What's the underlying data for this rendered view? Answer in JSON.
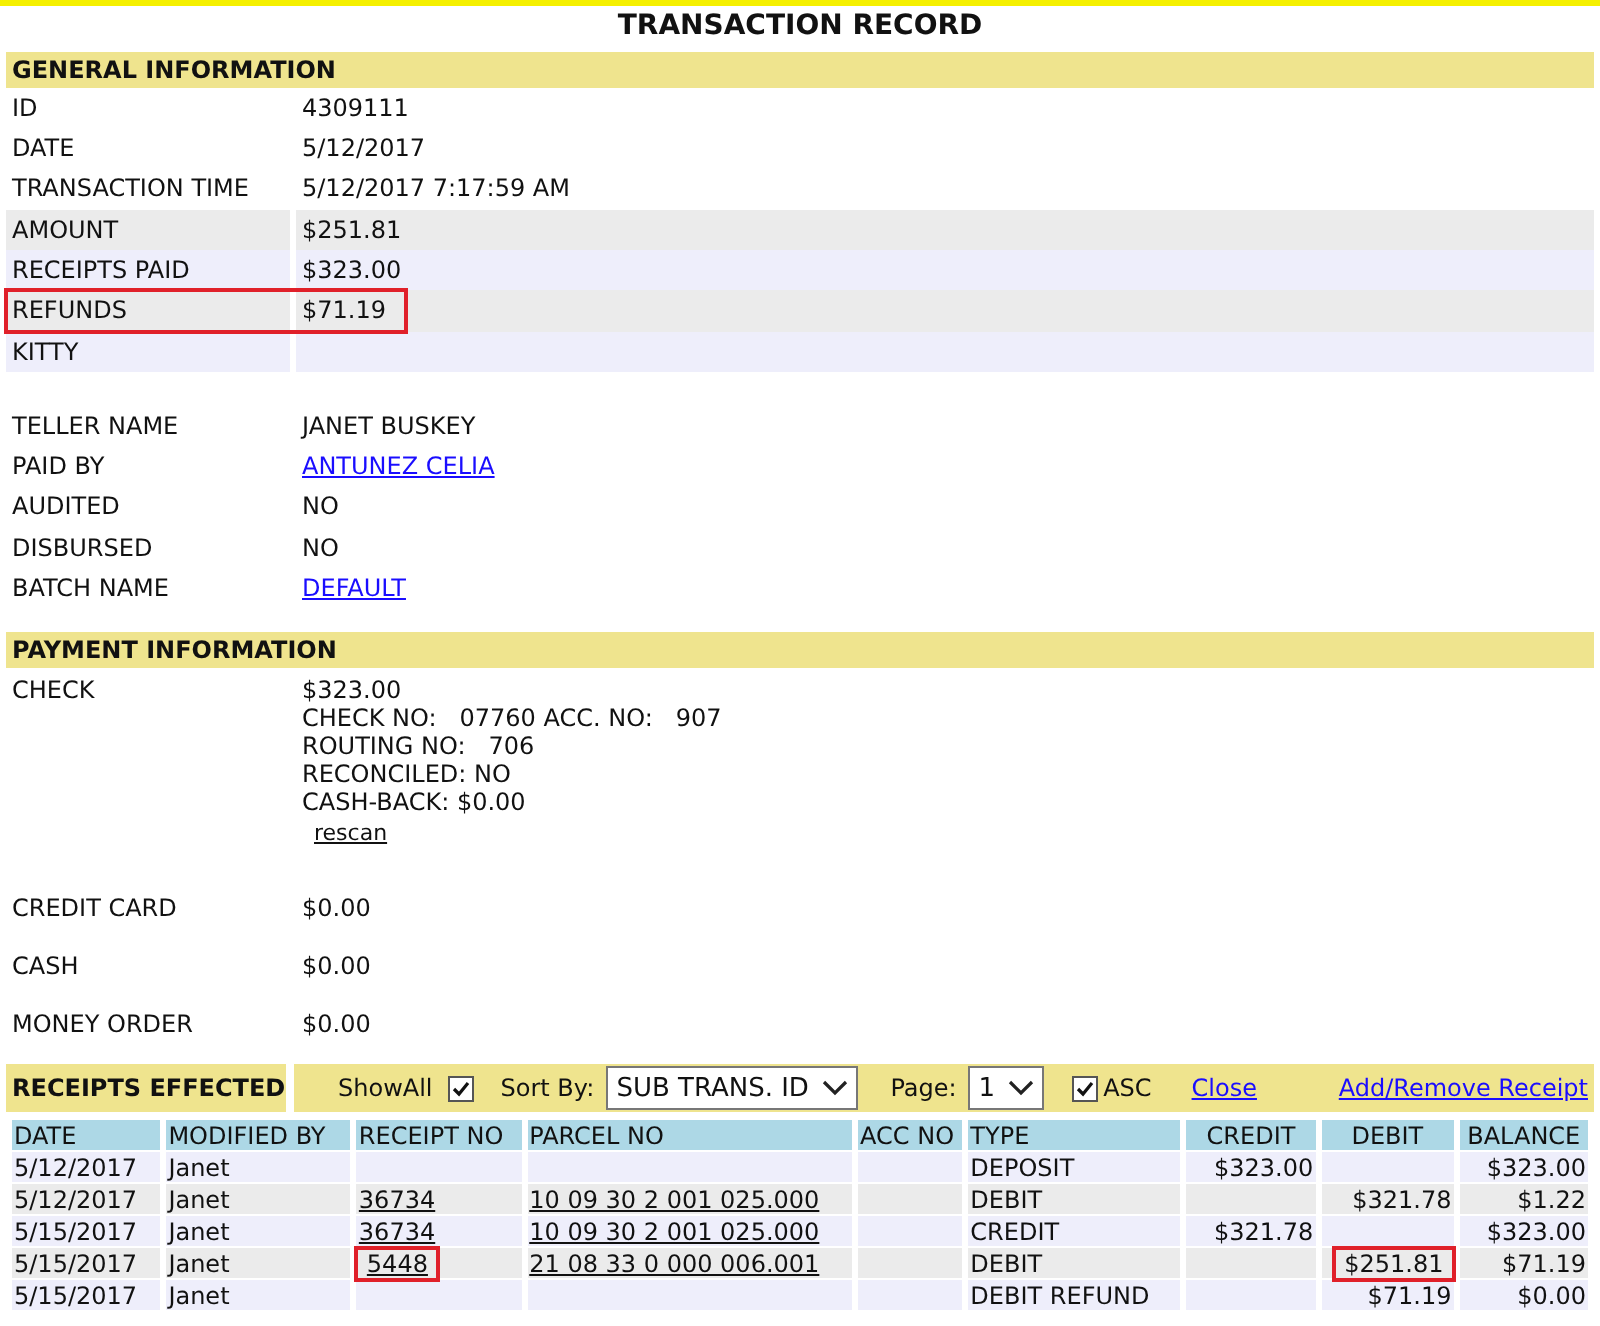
{
  "title": "TRANSACTION RECORD",
  "general": {
    "heading": "GENERAL INFORMATION",
    "basic_rows": [
      {
        "label": "ID",
        "value": "4309111"
      },
      {
        "label": "DATE",
        "value": "5/12/2017"
      },
      {
        "label": "TRANSACTION TIME",
        "value": "5/12/2017 7:17:59 AM"
      }
    ],
    "amount_rows": [
      {
        "label": "AMOUNT",
        "value": "$251.81",
        "highlighted": false
      },
      {
        "label": "RECEIPTS PAID",
        "value": "$323.00",
        "highlighted": false
      },
      {
        "label": "REFUNDS",
        "value": "$71.19",
        "highlighted": true
      },
      {
        "label": "KITTY",
        "value": "",
        "highlighted": false
      }
    ],
    "detail_rows": [
      {
        "label": "TELLER NAME",
        "value": "JANET BUSKEY",
        "kind": "text"
      },
      {
        "label": "PAID BY",
        "value": "ANTUNEZ CELIA",
        "kind": "link"
      },
      {
        "label": "AUDITED",
        "value": "NO",
        "kind": "text"
      },
      {
        "label": "DISBURSED",
        "value": "NO",
        "kind": "text"
      },
      {
        "label": "BATCH NAME",
        "value": "DEFAULT",
        "kind": "link"
      }
    ]
  },
  "payment": {
    "heading": "PAYMENT INFORMATION",
    "check": {
      "label": "CHECK",
      "amount": "$323.00",
      "lines": [
        "CHECK NO:   07760 ACC. NO:   907",
        "ROUTING NO:   706",
        "RECONCILED: NO",
        "CASH-BACK: $0.00"
      ],
      "link": "rescan"
    },
    "rows": [
      {
        "label": "CREDIT CARD",
        "value": "$0.00"
      },
      {
        "label": "CASH",
        "value": "$0.00"
      },
      {
        "label": "MONEY ORDER",
        "value": "$0.00"
      }
    ]
  },
  "receipts": {
    "heading": "RECEIPTS EFFECTED",
    "show_all": {
      "label": "ShowAll",
      "checked": true
    },
    "sort_by": {
      "label": "Sort By:",
      "value": "SUB TRANS. ID"
    },
    "page": {
      "label": "Page:",
      "value": "1"
    },
    "asc": {
      "label": "ASC",
      "checked": true
    },
    "links": [
      "Close",
      "Add/Remove Receipt"
    ],
    "columns": [
      "DATE",
      "MODIFIED BY",
      "RECEIPT NO",
      "PARCEL NO",
      "ACC NO",
      "TYPE",
      "CREDIT",
      "DEBIT",
      "BALANCE"
    ],
    "rows": [
      {
        "date": "5/12/2017",
        "modified_by": "Janet",
        "receipt_no": "",
        "parcel_no": "",
        "acc_no": "",
        "type": "DEPOSIT",
        "credit": "$323.00",
        "debit": "",
        "balance": "$323.00",
        "receipt_highlighted": false,
        "debit_highlighted": false
      },
      {
        "date": "5/12/2017",
        "modified_by": "Janet",
        "receipt_no": "36734",
        "parcel_no": "10 09 30 2 001 025.000",
        "acc_no": "",
        "type": "DEBIT",
        "credit": "",
        "debit": "$321.78",
        "balance": "$1.22",
        "receipt_highlighted": false,
        "debit_highlighted": false
      },
      {
        "date": "5/15/2017",
        "modified_by": "Janet",
        "receipt_no": "36734",
        "parcel_no": "10 09 30 2 001 025.000",
        "acc_no": "",
        "type": "CREDIT",
        "credit": "$321.78",
        "debit": "",
        "balance": "$323.00",
        "receipt_highlighted": false,
        "debit_highlighted": false
      },
      {
        "date": "5/15/2017",
        "modified_by": "Janet",
        "receipt_no": "5448",
        "parcel_no": "21 08 33 0 000 006.001",
        "acc_no": "",
        "type": "DEBIT",
        "credit": "",
        "debit": "$251.81",
        "balance": "$71.19",
        "receipt_highlighted": true,
        "debit_highlighted": true
      },
      {
        "date": "5/15/2017",
        "modified_by": "Janet",
        "receipt_no": "",
        "parcel_no": "",
        "acc_no": "",
        "type": "DEBIT REFUND",
        "credit": "",
        "debit": "$71.19",
        "balance": "$0.00",
        "receipt_highlighted": false,
        "debit_highlighted": false
      }
    ]
  }
}
